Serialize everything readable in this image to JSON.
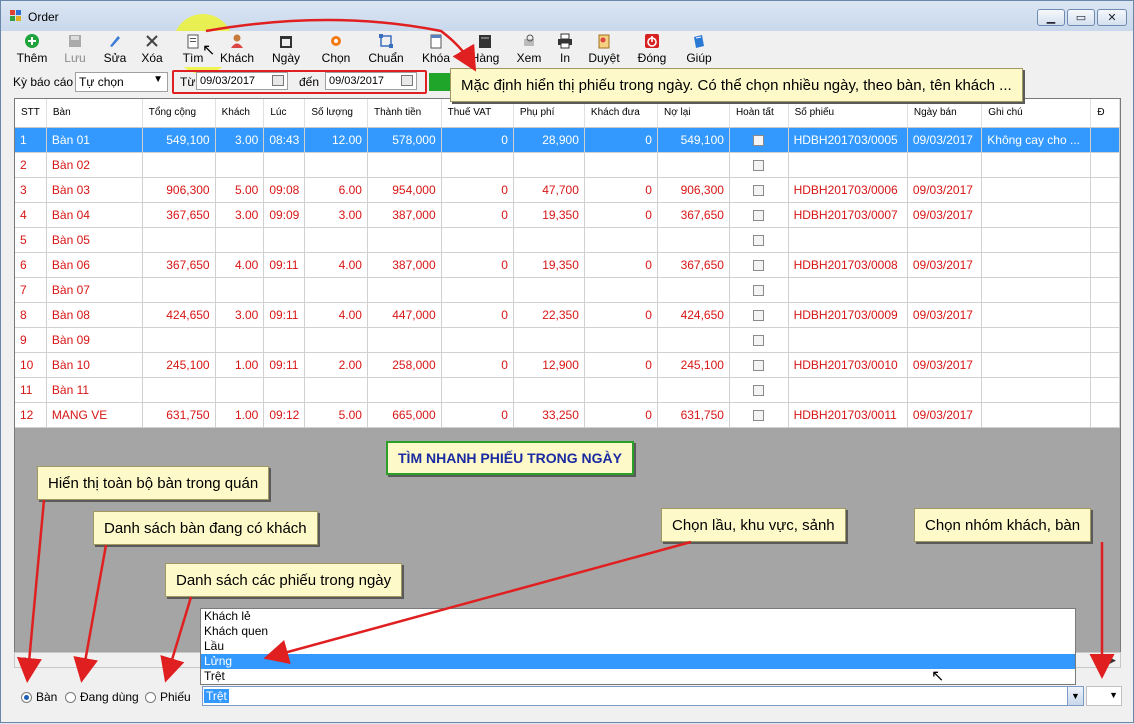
{
  "window": {
    "title": "Order"
  },
  "toolbar": [
    {
      "label": "Thêm",
      "icon": "add-icon"
    },
    {
      "label": "Lưu",
      "icon": "save-icon",
      "disabled": true
    },
    {
      "label": "Sửa",
      "icon": "edit-icon"
    },
    {
      "label": "Xóa",
      "icon": "delete-icon"
    },
    {
      "label": "Tìm",
      "icon": "find-icon"
    },
    {
      "label": "Khách",
      "icon": "customer-icon"
    },
    {
      "label": "Ngày",
      "icon": "day-icon"
    },
    {
      "label": "Chọn",
      "icon": "select-icon"
    },
    {
      "label": "Chuẩn",
      "icon": "standard-icon"
    },
    {
      "label": "Khóa",
      "icon": "lock-icon"
    },
    {
      "label": "Hàng",
      "icon": "goods-icon"
    },
    {
      "label": "Xem",
      "icon": "view-icon"
    },
    {
      "label": "In",
      "icon": "print-icon"
    },
    {
      "label": "Duyệt",
      "icon": "approve-icon"
    },
    {
      "label": "Đóng",
      "icon": "close-app-icon"
    },
    {
      "label": "Giúp",
      "icon": "help-icon"
    }
  ],
  "filter": {
    "period_label": "Kỳ báo cáo",
    "period_value": "Tự chọn",
    "from_label": "Từ",
    "from_date": "09/03/2017",
    "to_label": "đến",
    "to_date": "09/03/2017"
  },
  "grid": {
    "columns": [
      "STT",
      "Bàn",
      "Tổng cộng",
      "Khách",
      "Lúc",
      "Số lượng",
      "Thành tiền",
      "Thuế VAT",
      "Phụ phí",
      "Khách đưa",
      "Nợ lại",
      "Hoàn tất",
      "Số phiếu",
      "Ngày bán",
      "Ghi chú",
      "Đ"
    ],
    "rows": [
      [
        "1",
        "Bàn 01",
        "549,100",
        "3.00",
        "08:43",
        "12.00",
        "578,000",
        "0",
        "28,900",
        "0",
        "549,100",
        "",
        "HDBH201703/0005",
        "09/03/2017",
        "Không cay cho ..."
      ],
      [
        "2",
        "Bàn 02",
        "",
        "",
        "",
        "",
        "",
        "",
        "",
        "",
        "",
        "",
        "",
        "",
        ""
      ],
      [
        "3",
        "Bàn 03",
        "906,300",
        "5.00",
        "09:08",
        "6.00",
        "954,000",
        "0",
        "47,700",
        "0",
        "906,300",
        "",
        "HDBH201703/0006",
        "09/03/2017",
        ""
      ],
      [
        "4",
        "Bàn 04",
        "367,650",
        "3.00",
        "09:09",
        "3.00",
        "387,000",
        "0",
        "19,350",
        "0",
        "367,650",
        "",
        "HDBH201703/0007",
        "09/03/2017",
        ""
      ],
      [
        "5",
        "Bàn 05",
        "",
        "",
        "",
        "",
        "",
        "",
        "",
        "",
        "",
        "",
        "",
        "",
        ""
      ],
      [
        "6",
        "Bàn 06",
        "367,650",
        "4.00",
        "09:11",
        "4.00",
        "387,000",
        "0",
        "19,350",
        "0",
        "367,650",
        "",
        "HDBH201703/0008",
        "09/03/2017",
        ""
      ],
      [
        "7",
        "Bàn 07",
        "",
        "",
        "",
        "",
        "",
        "",
        "",
        "",
        "",
        "",
        "",
        "",
        ""
      ],
      [
        "8",
        "Bàn 08",
        "424,650",
        "3.00",
        "09:11",
        "4.00",
        "447,000",
        "0",
        "22,350",
        "0",
        "424,650",
        "",
        "HDBH201703/0009",
        "09/03/2017",
        ""
      ],
      [
        "9",
        "Bàn 09",
        "",
        "",
        "",
        "",
        "",
        "",
        "",
        "",
        "",
        "",
        "",
        "",
        ""
      ],
      [
        "10",
        "Bàn 10",
        "245,100",
        "1.00",
        "09:11",
        "2.00",
        "258,000",
        "0",
        "12,900",
        "0",
        "245,100",
        "",
        "HDBH201703/0010",
        "09/03/2017",
        ""
      ],
      [
        "11",
        "Bàn 11",
        "",
        "",
        "",
        "",
        "",
        "",
        "",
        "",
        "",
        "",
        "",
        "",
        ""
      ],
      [
        "12",
        "MANG VE",
        "631,750",
        "1.00",
        "09:12",
        "5.00",
        "665,000",
        "0",
        "33,250",
        "0",
        "631,750",
        "",
        "HDBH201703/0011",
        "09/03/2017",
        ""
      ]
    ],
    "selected_row": 0
  },
  "bottom": {
    "radios": [
      {
        "label": "Bàn",
        "checked": true
      },
      {
        "label": "Đang dùng",
        "checked": false
      },
      {
        "label": "Phiếu",
        "checked": false
      }
    ],
    "area_value": "Trệt",
    "dropdown_options": [
      "Khách lẻ",
      "Khách quen",
      "Lầu",
      "Lửng",
      "Trệt"
    ],
    "dropdown_highlight": 3
  },
  "callouts": {
    "default_day": "Mặc định hiển thị phiếu trong ngày. Có thể chọn nhiều ngày, theo bàn, tên khách ...",
    "quick_find": "TÌM NHANH PHIẾU TRONG NGÀY",
    "all_tables": "Hiển thị toàn bộ bàn trong quán",
    "busy_tables": "Danh sách bàn đang có khách",
    "day_tickets": "Danh sách các phiếu trong ngày",
    "choose_area": "Chọn lầu, khu vực, sảnh",
    "choose_group": "Chọn nhóm khách, bàn"
  },
  "colors": {
    "row_text": "#d81515",
    "selection": "#3399ff",
    "callout_arrow": "#e02020"
  }
}
